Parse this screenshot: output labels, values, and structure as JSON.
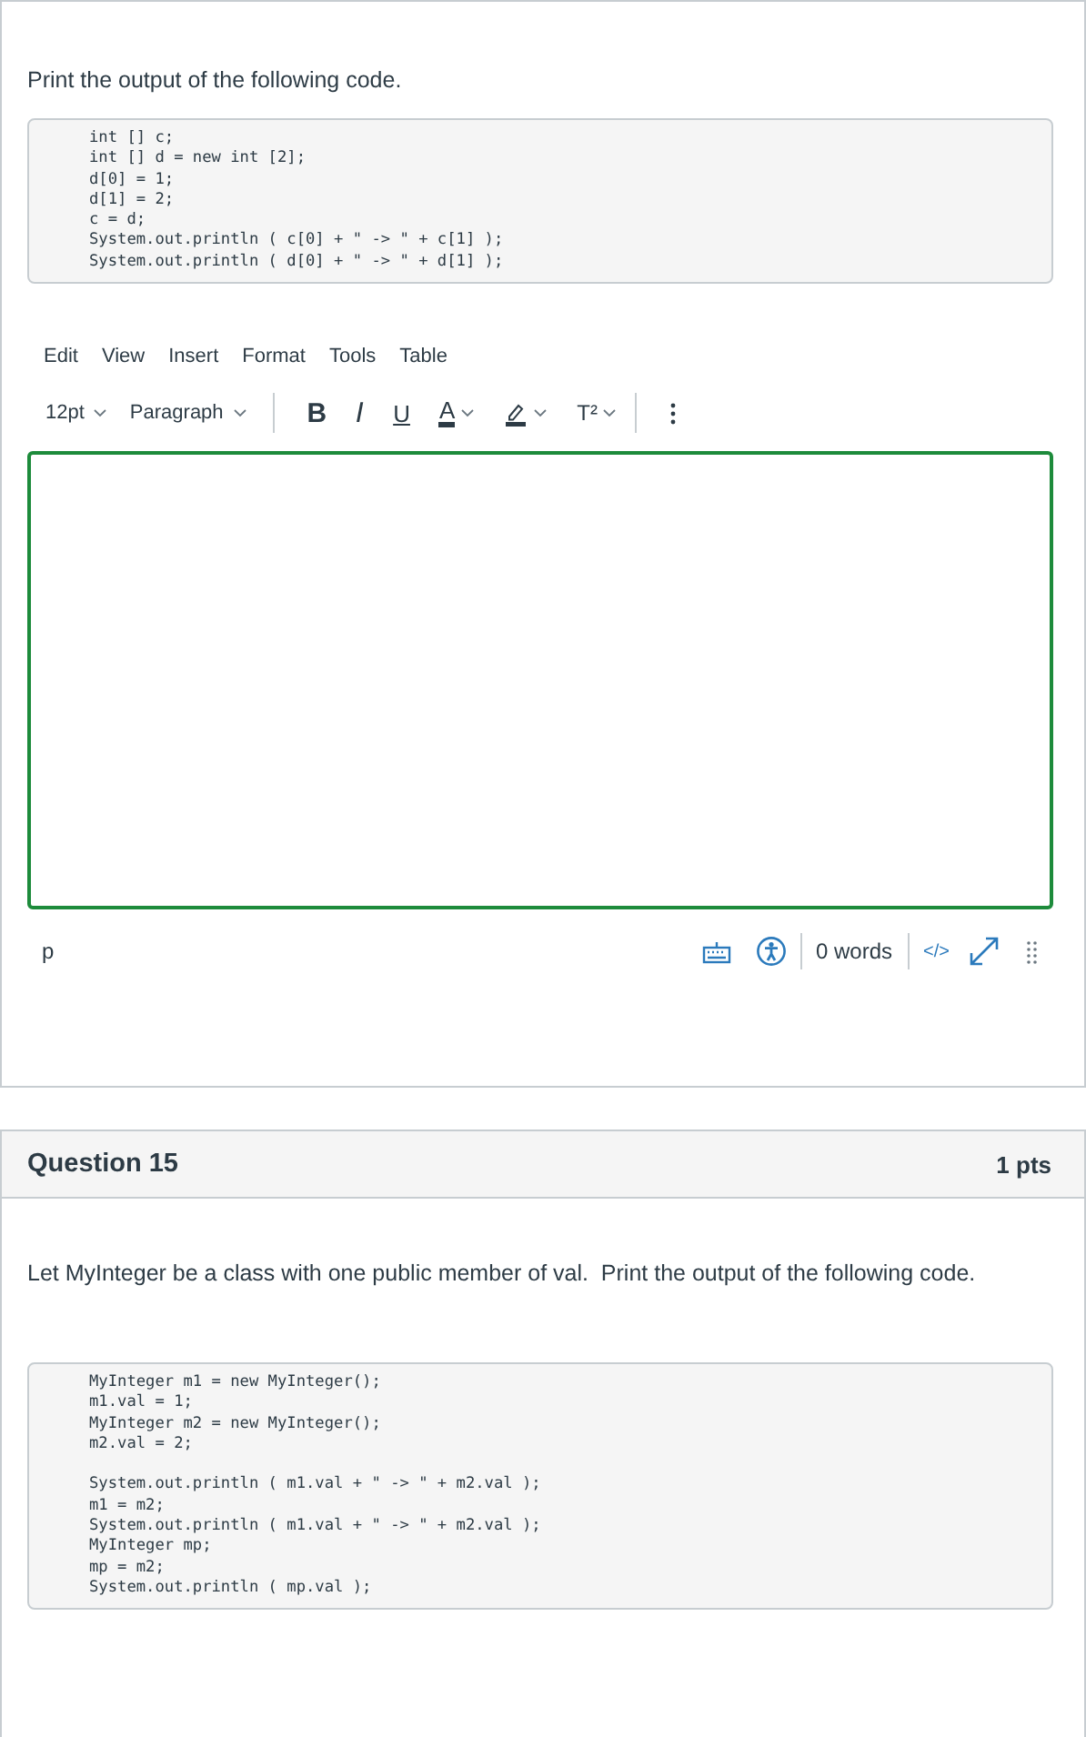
{
  "question_14": {
    "prompt": "Print the output of the following code.",
    "code_groups": [
      [
        "int [] c;",
        "int [] d = new int [2];",
        "d[0] = 1;",
        "d[1] = 2;",
        "c = d;",
        "System.out.println ( c[0] + \" -> \" + c[1] );",
        "System.out.println ( d[0] + \" -> \" + d[1] );"
      ]
    ],
    "editor": {
      "menu": [
        "Edit",
        "View",
        "Insert",
        "Format",
        "Tools",
        "Table"
      ],
      "toolbar": [
        {
          "kind": "dropdown",
          "label": "12pt"
        },
        {
          "kind": "dropdown",
          "label": "Paragraph"
        },
        {
          "kind": "divider"
        },
        {
          "kind": "bold",
          "label": "B"
        },
        {
          "kind": "italic",
          "label": "I"
        },
        {
          "kind": "underline",
          "label": "U"
        },
        {
          "kind": "textcolor",
          "label": "A"
        },
        {
          "kind": "highlight"
        },
        {
          "kind": "superscript",
          "label": "T²"
        },
        {
          "kind": "divider"
        },
        {
          "kind": "more"
        }
      ],
      "focused": true,
      "status": {
        "path": "p",
        "word_count": "0 words",
        "html_toggle": "</>"
      }
    }
  },
  "question_15": {
    "title": "Question 15",
    "points": "1 pts",
    "prompt": "Let MyInteger be a class with one public member of val.  Print the output of the following code.",
    "code_groups": [
      [
        "MyInteger m1 = new MyInteger();",
        "m1.val = 1;",
        "MyInteger m2 = new MyInteger();",
        "m2.val = 2;"
      ],
      [
        "System.out.println ( m1.val + \" -> \" + m2.val );",
        "m1 = m2;",
        "System.out.println ( m1.val + \" -> \" + m2.val );",
        "MyInteger mp;",
        "mp = m2;",
        "System.out.println ( mp.val );"
      ]
    ]
  }
}
